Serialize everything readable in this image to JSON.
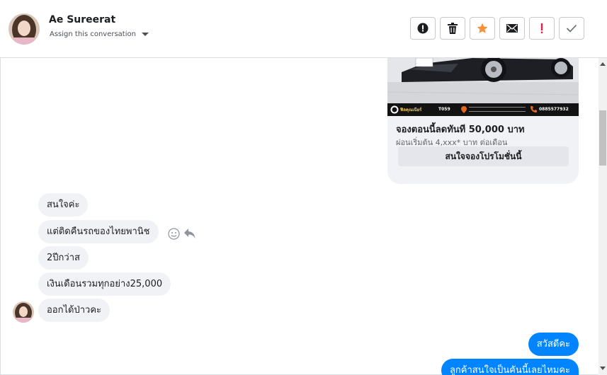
{
  "header": {
    "contact_name": "Ae Sureerat",
    "assign_label": "Assign this conversation",
    "actions": [
      {
        "name": "spam-button",
        "icon": "alert-circle-icon"
      },
      {
        "name": "delete-button",
        "icon": "trash-icon"
      },
      {
        "name": "star-button",
        "icon": "star-icon"
      },
      {
        "name": "mark-unread-button",
        "icon": "envelope-icon"
      },
      {
        "name": "important-button",
        "icon": "exclamation-icon"
      },
      {
        "name": "mark-done-button",
        "icon": "checkmark-icon"
      }
    ]
  },
  "promo_card": {
    "strip_brand": "ฟิลคุณเนียร์",
    "strip_code": "T059",
    "strip_phone": "0885577932",
    "title": "จองตอนนี้ลดทันที 50,000 บาท",
    "subtitle": "ผ่อนเริ่มต้น 4,xxx* บาท ต่อเดือน",
    "cta_label": "สนใจจองโปรโมชั่นนี้"
  },
  "messages_in": [
    {
      "text": "สนใจค่ะ"
    },
    {
      "text": "แต่ติดคืนรถของไทยพานิช"
    },
    {
      "text": "2ปีกว่าส"
    },
    {
      "text": "เงินเดือนรวมทุกอย่าง25,000"
    },
    {
      "text": "ออกได้ป่าวคะ"
    }
  ],
  "messages_out": [
    {
      "text": "สวัสดีคะ"
    },
    {
      "text": "ลูกค้าสนใจเป็นคันนี้เลยไหมคะ"
    }
  ],
  "colors": {
    "accent_blue": "#0084ff",
    "star_orange": "#f7923a",
    "important_red": "#e41e3f",
    "incoming_bubble": "#f0f2f5"
  }
}
